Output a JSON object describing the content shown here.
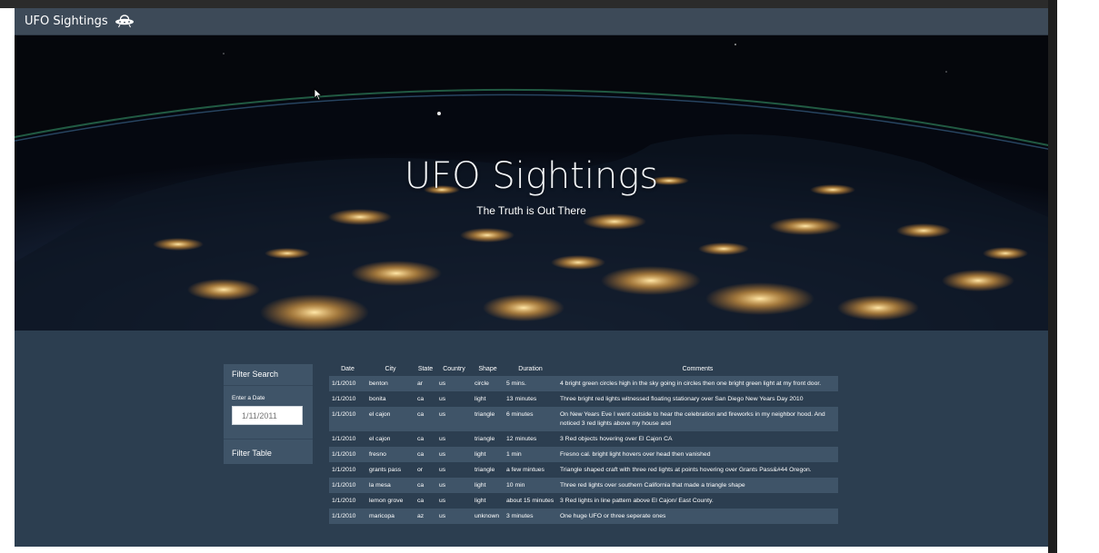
{
  "navbar": {
    "brand": "UFO Sightings",
    "brand_icon": "ufo-icon"
  },
  "hero": {
    "title": "UFO Sightings",
    "subtitle": "The Truth is Out There"
  },
  "filter": {
    "title": "Filter Search",
    "date_label": "Enter a Date",
    "date_placeholder": "1/11/2011",
    "button_label": "Filter Table"
  },
  "table": {
    "headers": [
      "Date",
      "City",
      "State",
      "Country",
      "Shape",
      "Duration",
      "Comments"
    ],
    "rows": [
      [
        "1/1/2010",
        "benton",
        "ar",
        "us",
        "circle",
        "5 mins.",
        "4 bright green circles high in the sky going in circles then one bright green light at my front door."
      ],
      [
        "1/1/2010",
        "bonita",
        "ca",
        "us",
        "light",
        "13 minutes",
        "Three bright red lights witnessed floating stationary over San Diego New Years Day 2010"
      ],
      [
        "1/1/2010",
        "el cajon",
        "ca",
        "us",
        "triangle",
        "6 minutes",
        "On New Years Eve I went outside to hear the celebration and fireworks in my neighbor hood. And noticed 3 red lights above my house and"
      ],
      [
        "1/1/2010",
        "el cajon",
        "ca",
        "us",
        "triangle",
        "12 minutes",
        "3 Red objects hovering over El Cajon CA"
      ],
      [
        "1/1/2010",
        "fresno",
        "ca",
        "us",
        "light",
        "1 min",
        "Fresno cal. bright light hovers over head then vanished"
      ],
      [
        "1/1/2010",
        "grants pass",
        "or",
        "us",
        "triangle",
        "a few mintues",
        "Triangle shaped craft with three red lights at points hovering over Grants Pass&#44 Oregon."
      ],
      [
        "1/1/2010",
        "la mesa",
        "ca",
        "us",
        "light",
        "10 min",
        "Three red lights over southern California that made a triangle shape"
      ],
      [
        "1/1/2010",
        "lemon grove",
        "ca",
        "us",
        "light",
        "about 15 minutes",
        "3 Red lights in line pattern above El Cajon/ East County."
      ],
      [
        "1/1/2010",
        "maricopa",
        "az",
        "us",
        "unknown",
        "3 minutes",
        "One huge UFO or three seperate ones"
      ]
    ]
  }
}
